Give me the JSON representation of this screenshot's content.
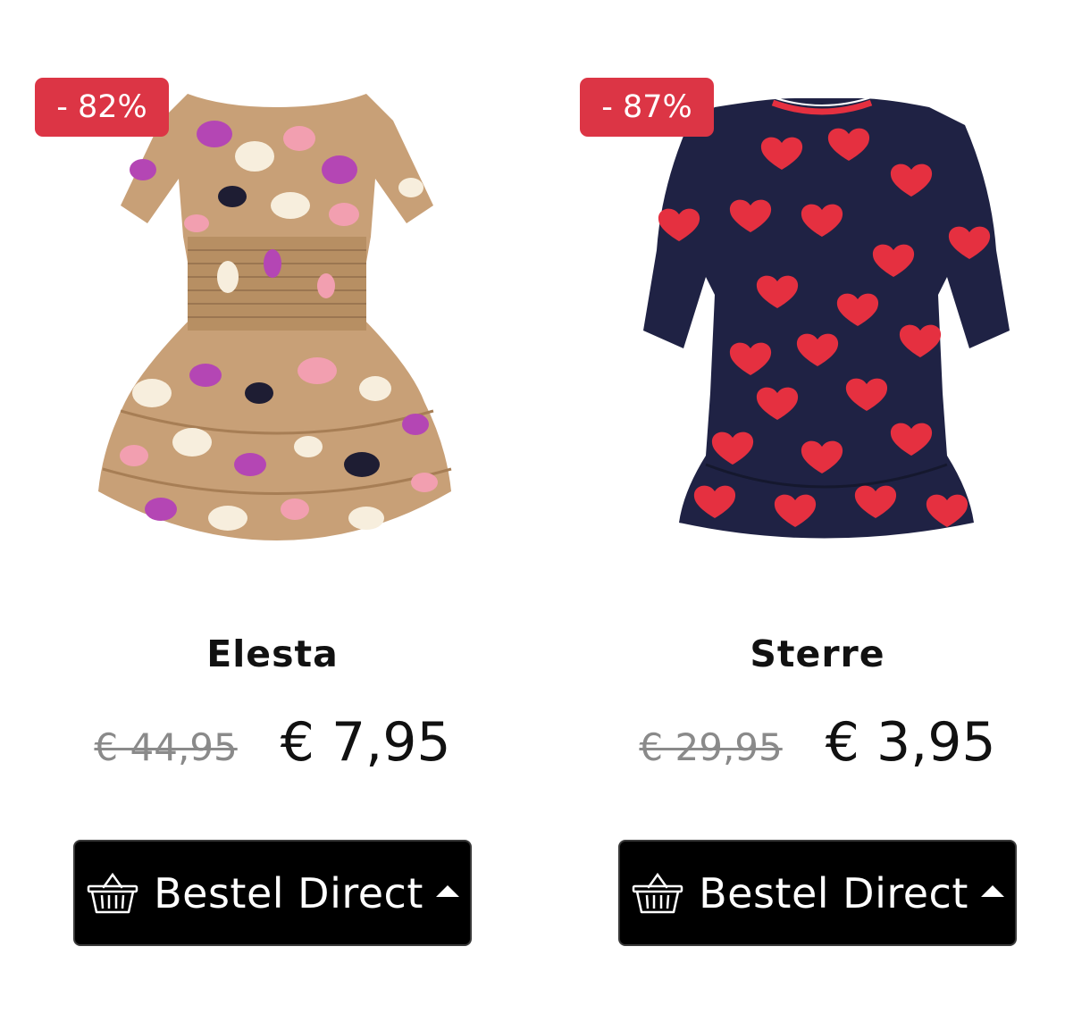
{
  "colors": {
    "badge": "#dc3545",
    "button": "#000000",
    "old_price": "#8a8a8a"
  },
  "products": [
    {
      "badge": "- 82%",
      "name": "Elesta",
      "old_price": "€ 44,95",
      "price": "€ 7,95",
      "button_label": "Bestel Direct",
      "button_icon": "basket-icon",
      "dropdown_icon": "caret-up-icon"
    },
    {
      "badge": "- 87%",
      "name": "Sterre",
      "old_price": "€ 29,95",
      "price": "€ 3,95",
      "button_label": "Bestel Direct",
      "button_icon": "basket-icon",
      "dropdown_icon": "caret-up-icon"
    }
  ]
}
